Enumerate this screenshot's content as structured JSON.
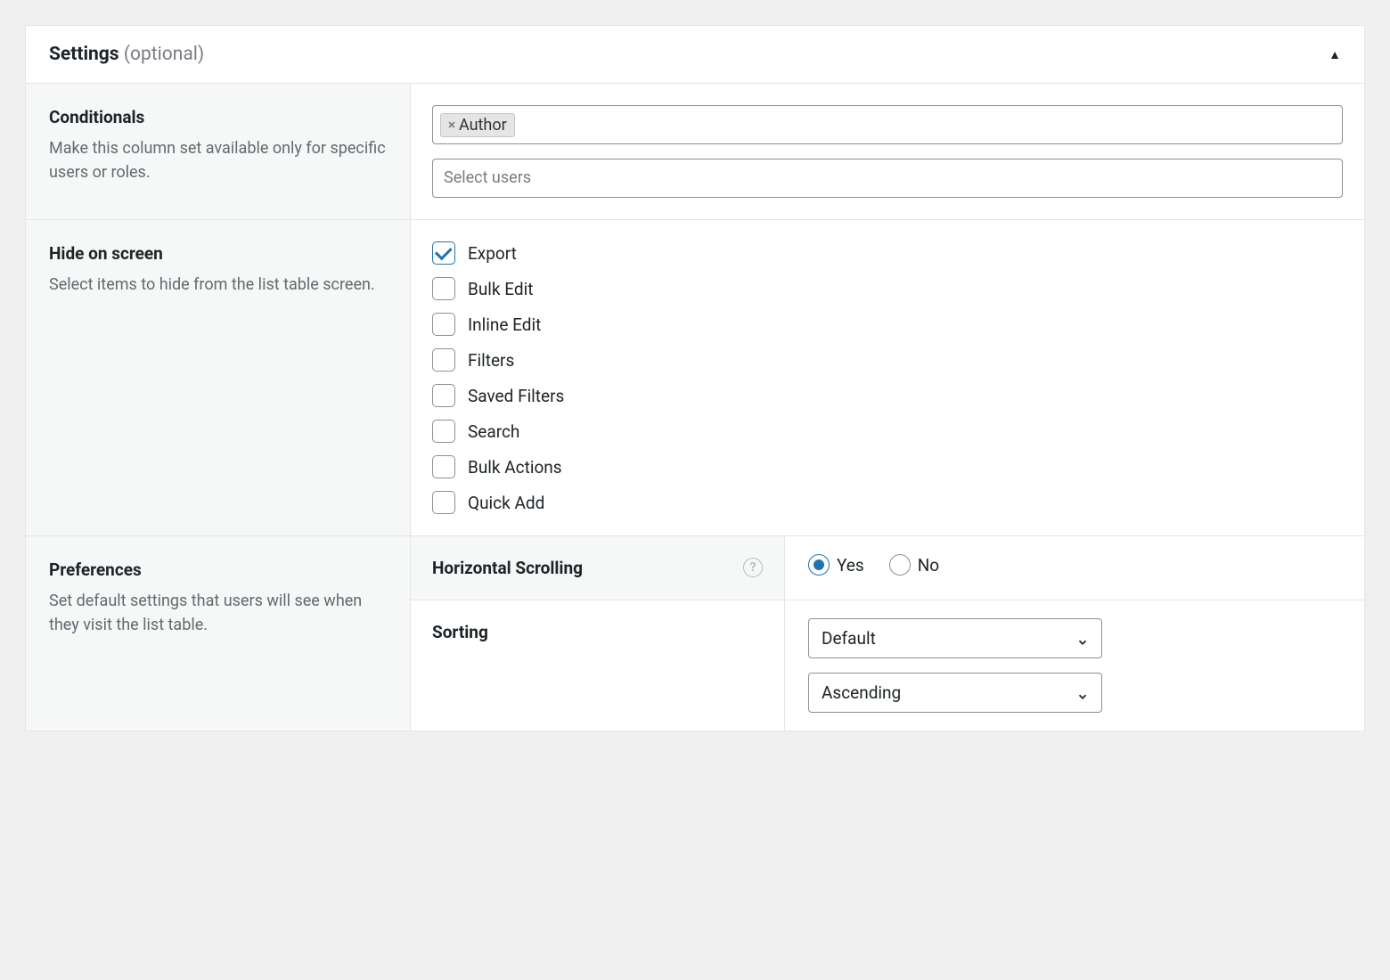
{
  "header": {
    "title": "Settings",
    "subtitle": "(optional)"
  },
  "conditionals": {
    "label": "Conditionals",
    "desc": "Make this column set available only for specific users or roles.",
    "tag": "Author",
    "users_placeholder": "Select users"
  },
  "hide": {
    "label": "Hide on screen",
    "desc": "Select items to hide from the list table screen.",
    "items": [
      {
        "label": "Export",
        "checked": true
      },
      {
        "label": "Bulk Edit",
        "checked": false
      },
      {
        "label": "Inline Edit",
        "checked": false
      },
      {
        "label": "Filters",
        "checked": false
      },
      {
        "label": "Saved Filters",
        "checked": false
      },
      {
        "label": "Search",
        "checked": false
      },
      {
        "label": "Bulk Actions",
        "checked": false
      },
      {
        "label": "Quick Add",
        "checked": false
      }
    ]
  },
  "prefs": {
    "label": "Preferences",
    "desc": "Set default settings that users will see when they visit the list table.",
    "hscroll": {
      "label": "Horizontal Scrolling",
      "yes": "Yes",
      "no": "No",
      "value": "yes"
    },
    "sorting": {
      "label": "Sorting",
      "column": "Default",
      "order": "Ascending"
    }
  }
}
